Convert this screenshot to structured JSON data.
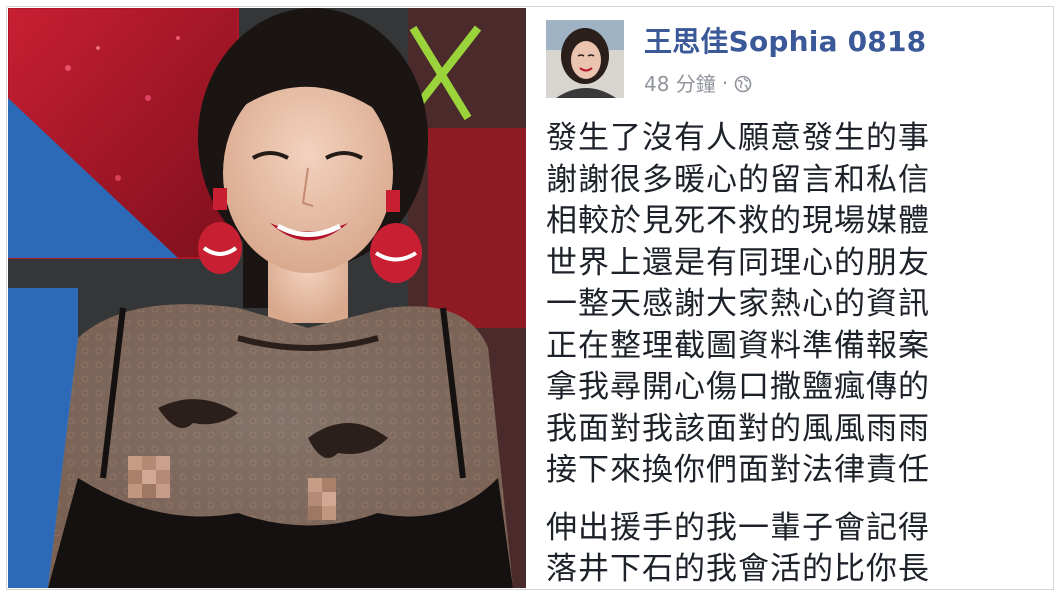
{
  "post": {
    "author_name": "王思佳Sophia 0818",
    "timestamp": "48 分鐘",
    "separator": "·",
    "privacy_icon": "globe-icon",
    "body_lines": [
      "發生了沒有人願意發生的事",
      "謝謝很多暖心的留言和私信",
      "相較於見死不救的現場媒體",
      "世界上還是有同理心的朋友",
      "一整天感謝大家熱心的資訊",
      "正在整理截圖資料準備報案",
      "拿我尋開心傷口撒鹽瘋傳的",
      "我面對我該面對的風風雨雨",
      "接下來換你們面對法律責任"
    ],
    "closing_lines": [
      "伸出援手的我一輩子會記得",
      "落井下石的我會活的比你長"
    ]
  },
  "colors": {
    "author_link": "#3b5998",
    "meta_gray": "#90949c",
    "body_text": "#1d2129"
  }
}
